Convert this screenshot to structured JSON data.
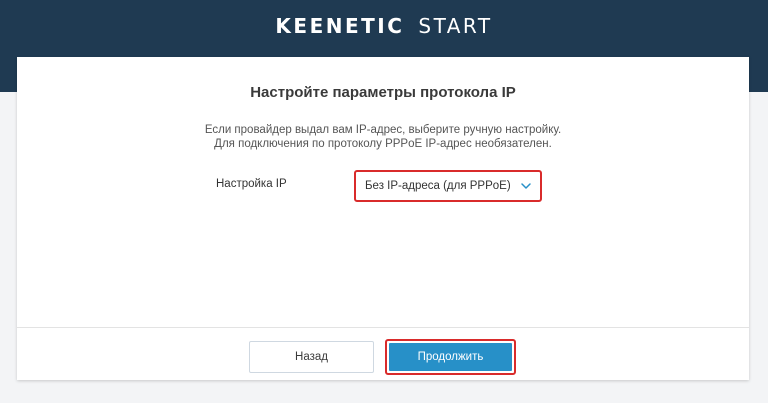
{
  "header": {
    "brand": "KEENETIC",
    "product": "START"
  },
  "page": {
    "title": "Настройте параметры протокола IP",
    "description_line1": "Если провайдер выдал вам IP-адрес, выберите ручную настройку.",
    "description_line2": "Для подключения по протоколу PPPoE IP-адрес необязателен."
  },
  "form": {
    "ip_setting_label": "Настройка IP",
    "ip_setting_value": "Без IP-адреса (для PPPoE)"
  },
  "buttons": {
    "back_label": "Назад",
    "continue_label": "Продолжить"
  },
  "colors": {
    "header_bg": "#1f3a52",
    "accent_blue": "#2790c8",
    "highlight_red": "#d92b2b"
  },
  "icons": {
    "select_arrow": "chevron-down-icon"
  }
}
